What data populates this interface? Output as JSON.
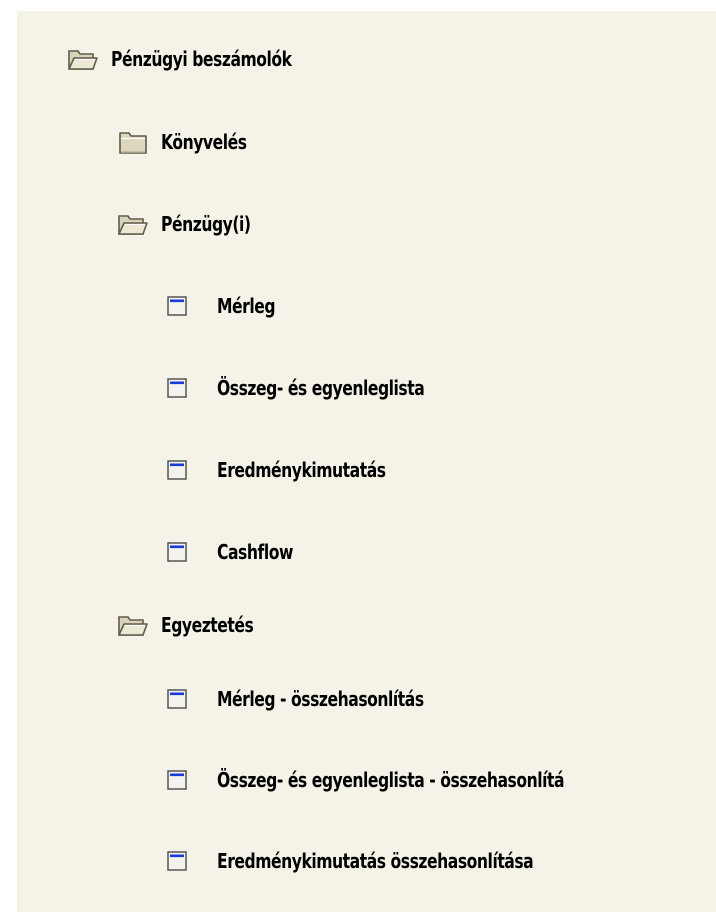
{
  "tree": {
    "root": {
      "label": "Pénzügyi beszámolók",
      "icon": "folder-open-icon",
      "expanded": true
    },
    "konyveles": {
      "label": "Könyvelés",
      "icon": "folder-closed-icon",
      "expanded": false
    },
    "penzugy": {
      "label": "Pénzügy(i)",
      "icon": "folder-open-icon",
      "expanded": true,
      "items": [
        {
          "label": "Mérleg",
          "icon": "report-icon"
        },
        {
          "label": "Összeg- és egyenleglista",
          "icon": "report-icon"
        },
        {
          "label": "Eredménykimutatás",
          "icon": "report-icon"
        },
        {
          "label": "Cashflow",
          "icon": "report-icon"
        }
      ]
    },
    "egyeztetes": {
      "label": "Egyeztetés",
      "icon": "folder-open-icon",
      "expanded": true,
      "items": [
        {
          "label": "Mérleg - összehasonlítás",
          "icon": "report-icon"
        },
        {
          "label": "Összeg- és egyenleglista - összehasonlítá",
          "icon": "report-icon"
        },
        {
          "label": "Eredménykimutatás összehasonlítása",
          "icon": "report-icon"
        }
      ]
    }
  },
  "colors": {
    "panel_background": "#f5f3e8",
    "folder_fill": "#e2dcc4",
    "folder_outline": "#6e6a5a",
    "report_accent": "#1a3ad8"
  }
}
